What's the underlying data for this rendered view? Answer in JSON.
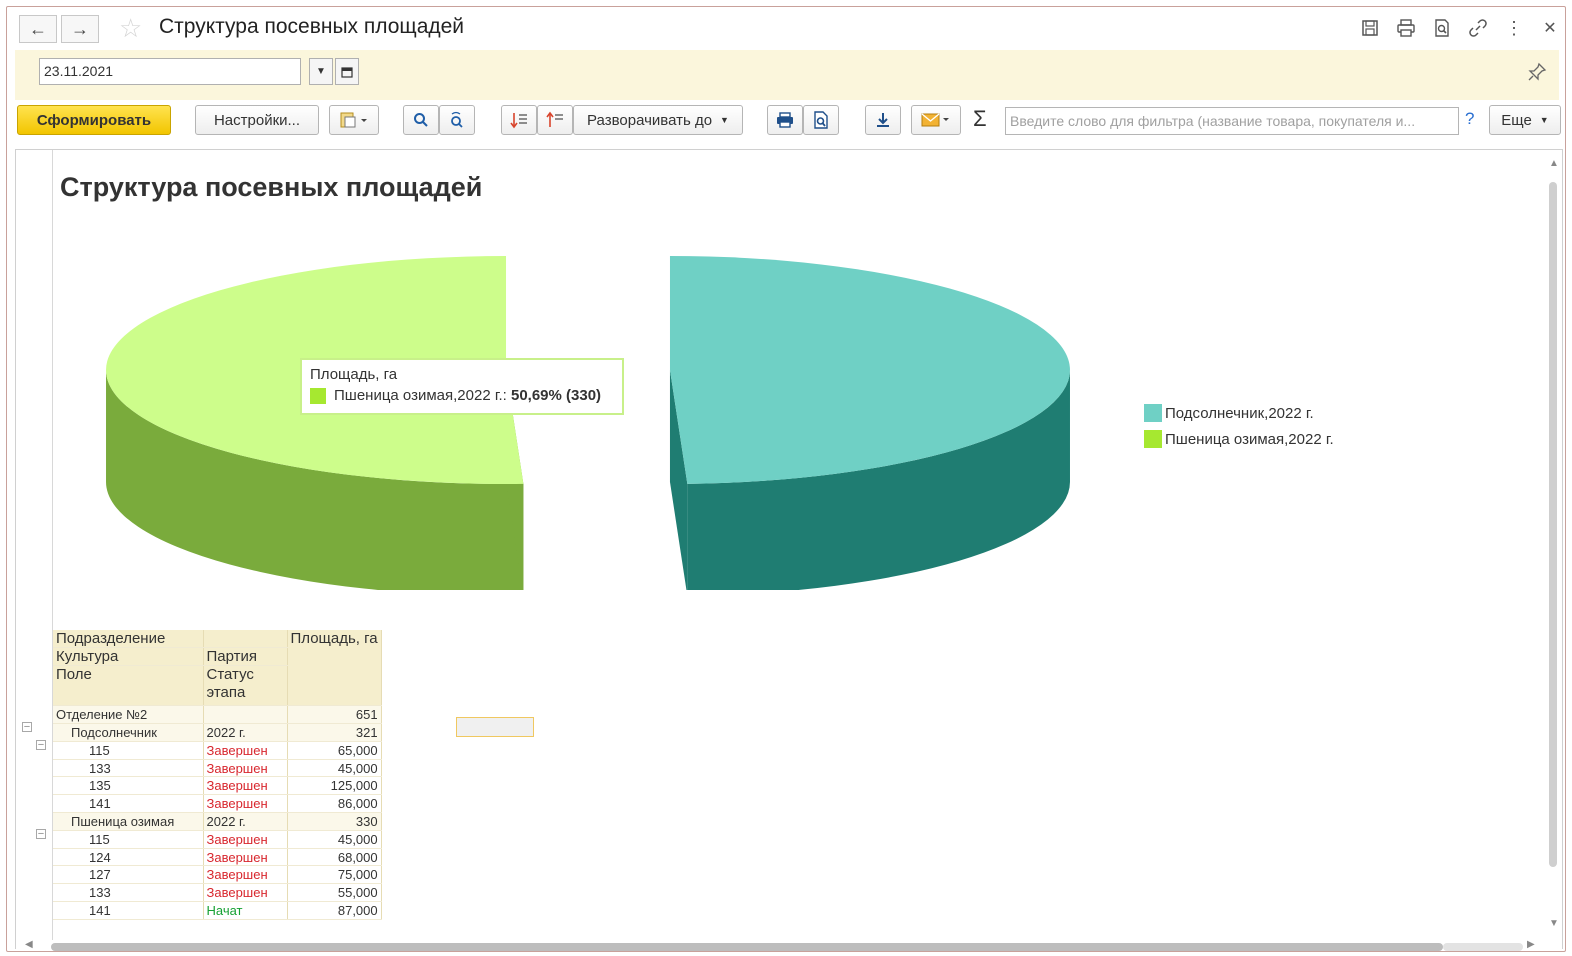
{
  "window": {
    "title": "Структура посевных площадей",
    "back_icon": "←",
    "forward_icon": "→"
  },
  "params": {
    "date_value": "23.11.2021"
  },
  "toolbar": {
    "generate_label": "Сформировать",
    "settings_label": "Настройки...",
    "expand_label": "Разворачивать до",
    "filter_placeholder": "Введите слово для фильтра (название товара, покупателя и...",
    "help_label": "?",
    "more_label": "Еще",
    "sigma_label": "Σ"
  },
  "report": {
    "title": "Структура посевных площадей"
  },
  "chart_data": {
    "type": "pie",
    "series_name": "Площадь, га",
    "categories": [
      "Подсолнечник,2022 г.",
      "Пшеница озимая,2022 г."
    ],
    "values": [
      321,
      330
    ],
    "colors": [
      "#6fd0c5",
      "#cdfd8b"
    ],
    "side_colors": [
      "#1f7d72",
      "#7aab3c"
    ],
    "legend_position": "right",
    "tooltip": {
      "title": "Площадь, га",
      "label": "Пшеница озимая,2022 г.: ",
      "value": "50,69% (330)"
    }
  },
  "table": {
    "header": {
      "col1_row1": "Подразделение",
      "col1_row2": "Культура",
      "col1_row3": "Поле",
      "col2_row2": "Партия",
      "col2_row3": "Статус этапа",
      "col3": "Площадь, га"
    },
    "division": {
      "name": "Отделение №2",
      "value": "651"
    },
    "groups": [
      {
        "name": "Подсолнечник",
        "batch": "2022 г.",
        "value": "321",
        "rows": [
          {
            "field": "115",
            "status": "Завершен",
            "status_kind": "done",
            "value": "65,000"
          },
          {
            "field": "133",
            "status": "Завершен",
            "status_kind": "done",
            "value": "45,000"
          },
          {
            "field": "135",
            "status": "Завершен",
            "status_kind": "done",
            "value": "125,000"
          },
          {
            "field": "141",
            "status": "Завершен",
            "status_kind": "done",
            "value": "86,000"
          }
        ]
      },
      {
        "name": "Пшеница озимая",
        "batch": "2022 г.",
        "value": "330",
        "rows": [
          {
            "field": "115",
            "status": "Завершен",
            "status_kind": "done",
            "value": "45,000"
          },
          {
            "field": "124",
            "status": "Завершен",
            "status_kind": "done",
            "value": "68,000"
          },
          {
            "field": "127",
            "status": "Завершен",
            "status_kind": "done",
            "value": "75,000"
          },
          {
            "field": "133",
            "status": "Завершен",
            "status_kind": "done",
            "value": "55,000"
          },
          {
            "field": "141",
            "status": "Начат",
            "status_kind": "started",
            "value": "87,000"
          }
        ]
      }
    ]
  }
}
